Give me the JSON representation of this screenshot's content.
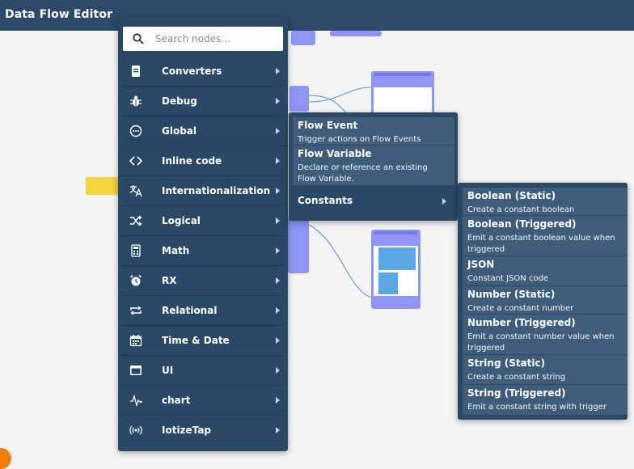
{
  "app": {
    "title": "Data Flow Editor"
  },
  "search": {
    "placeholder": "Search nodes..."
  },
  "menu": {
    "items": [
      {
        "label": "Converters",
        "icon": "document-icon"
      },
      {
        "label": "Debug",
        "icon": "bug-icon"
      },
      {
        "label": "Global",
        "icon": "ellipsis-circle-icon"
      },
      {
        "label": "Inline code",
        "icon": "code-brackets-icon"
      },
      {
        "label": "Internationalization",
        "icon": "translate-icon"
      },
      {
        "label": "Logical",
        "icon": "shuffle-icon"
      },
      {
        "label": "Math",
        "icon": "calculator-icon"
      },
      {
        "label": "RX",
        "icon": "alarm-clock-icon"
      },
      {
        "label": "Relational",
        "icon": "repeat-icon"
      },
      {
        "label": "Time & Date",
        "icon": "calendar-icon"
      },
      {
        "label": "UI",
        "icon": "window-icon"
      },
      {
        "label": "chart",
        "icon": "pulse-icon"
      },
      {
        "label": "IotizeTap",
        "icon": "radio-waves-icon"
      }
    ]
  },
  "global_submenu": {
    "items": [
      {
        "title": "Flow Event",
        "desc": "Trigger actions on Flow Events"
      },
      {
        "title": "Flow Variable",
        "desc": "Declare or reference an existing Flow Variable."
      },
      {
        "title": "Constants",
        "desc": ""
      }
    ]
  },
  "constants_submenu": {
    "items": [
      {
        "title": "Boolean (Static)",
        "desc": "Create a constant boolean"
      },
      {
        "title": "Boolean (Triggered)",
        "desc": "Emit a constant boolean value when triggered"
      },
      {
        "title": "JSON",
        "desc": "Constant JSON code"
      },
      {
        "title": "Number (Static)",
        "desc": "Create a constant number"
      },
      {
        "title": "Number (Triggered)",
        "desc": "Emit a constant number value when triggered"
      },
      {
        "title": "String (Static)",
        "desc": "Create a constant string"
      },
      {
        "title": "String (Triggered)",
        "desc": "Emit a constant string with trigger"
      }
    ]
  },
  "colors": {
    "titlebar": "#2d4a6a",
    "menu_bg": "#2b4866",
    "submenu_item_bg": "#3f5d7a",
    "node_purple": "#8e95f5",
    "node_yellow": "#f3d43a",
    "wire": "#5b8ec4",
    "accent_orange": "#ef7d12"
  }
}
